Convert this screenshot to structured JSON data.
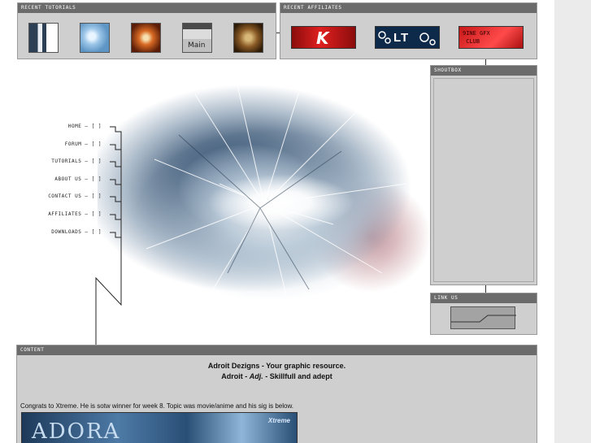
{
  "panels": {
    "recent_tutorials": "RECENT TUTORIALS",
    "recent_affiliates": "RECENT AFFILIATES",
    "shoutbox": "SHOUTBOX",
    "link_us": "LINK US",
    "content": "CONTENT"
  },
  "tutorial_thumb_4_label": "Main",
  "affiliates": {
    "a1_mark": "K",
    "a2_label": "LT",
    "a3_label": "9INE GFX\n CLUB"
  },
  "nav": [
    "HOME",
    "FORUM",
    "TUTORIALS",
    "ABOUT US",
    "CONTACT US",
    "AFFILIATES",
    "DOWNLOADS"
  ],
  "content": {
    "title": "Adroit Dezigns - Your graphic resource.",
    "sub_a": "Adroit - ",
    "sub_adj": "Adj.",
    "sub_b": " - Skillfull and adept",
    "news": "Congrats to Xtreme. He is sotw winner for week 8. Topic was movie/anime and his sig is below.",
    "sig_word": "ADORA",
    "sig_tag": "Xtreme"
  },
  "colors": {
    "panel_bg": "#cfcfcf",
    "panel_head": "#6b6b6b",
    "splash_blue": "#3f5a78"
  }
}
